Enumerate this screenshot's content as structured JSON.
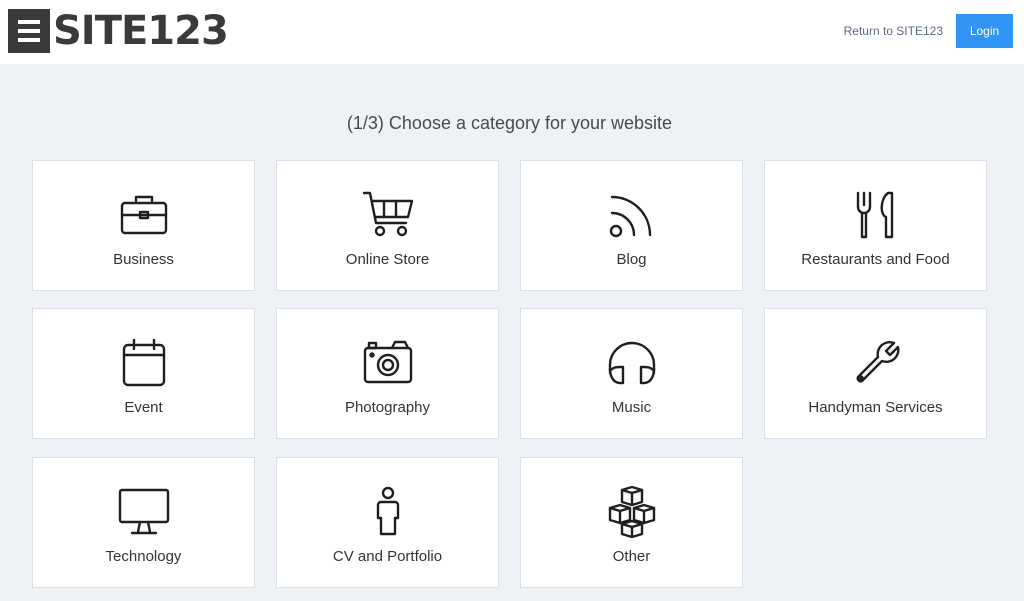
{
  "header": {
    "logo_text": "SITE123",
    "return_link": "Return to SITE123",
    "login_label": "Login"
  },
  "main": {
    "heading": "(1/3) Choose a category for your website",
    "categories": [
      {
        "label": "Business",
        "icon": "briefcase-icon"
      },
      {
        "label": "Online Store",
        "icon": "shopping-cart-icon"
      },
      {
        "label": "Blog",
        "icon": "rss-icon"
      },
      {
        "label": "Restaurants and Food",
        "icon": "fork-knife-icon"
      },
      {
        "label": "Event",
        "icon": "calendar-icon"
      },
      {
        "label": "Photography",
        "icon": "camera-icon"
      },
      {
        "label": "Music",
        "icon": "headphones-icon"
      },
      {
        "label": "Handyman Services",
        "icon": "wrench-icon"
      },
      {
        "label": "Technology",
        "icon": "monitor-icon"
      },
      {
        "label": "CV and Portfolio",
        "icon": "person-icon"
      },
      {
        "label": "Other",
        "icon": "cubes-icon"
      }
    ]
  }
}
